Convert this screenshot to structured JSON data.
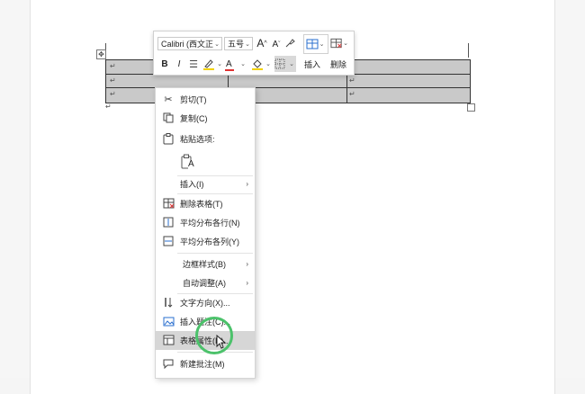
{
  "document": {
    "paragraph_mark": "↵",
    "table_handle_icon": "move-icon"
  },
  "toolbar": {
    "font_name": "Calibri (西文正",
    "font_size": "五号",
    "grow_font_label": "A",
    "shrink_font_label": "A",
    "bold_label": "B",
    "italic_label": "I",
    "font_color_label": "A",
    "insert_label": "插入",
    "delete_label": "删除",
    "colors": {
      "highlight": "#f2d200",
      "font_color": "#e03030"
    }
  },
  "menu": {
    "items": [
      {
        "label": "剪切(T)",
        "icon": "scissors-icon"
      },
      {
        "label": "复制(C)",
        "icon": "copy-icon"
      },
      {
        "label": "粘贴选项:",
        "icon": "paste-icon"
      },
      {
        "label": "A",
        "icon": "paste-keep-text-icon"
      },
      {
        "label": "插入(I)",
        "icon": "",
        "arrow": "›"
      },
      {
        "label": "删除表格(T)",
        "icon": "delete-table-icon"
      },
      {
        "label": "平均分布各行(N)",
        "icon": "distribute-rows-icon"
      },
      {
        "label": "平均分布各列(Y)",
        "icon": "distribute-columns-icon"
      },
      {
        "label": "边框样式(B)",
        "icon": "",
        "arrow": "›"
      },
      {
        "label": "自动调整(A)",
        "icon": "",
        "arrow": "›"
      },
      {
        "label": "文字方向(X)...",
        "icon": "text-direction-icon"
      },
      {
        "label": "插入题注(C)...",
        "icon": "insert-caption-icon"
      },
      {
        "label": "表格属性(R)...",
        "icon": "table-properties-icon"
      },
      {
        "label": "新建批注(M)",
        "icon": "new-comment-icon"
      }
    ],
    "highlight_color": "#d6d6d6",
    "cursor_ring_color": "#4cc26b"
  }
}
